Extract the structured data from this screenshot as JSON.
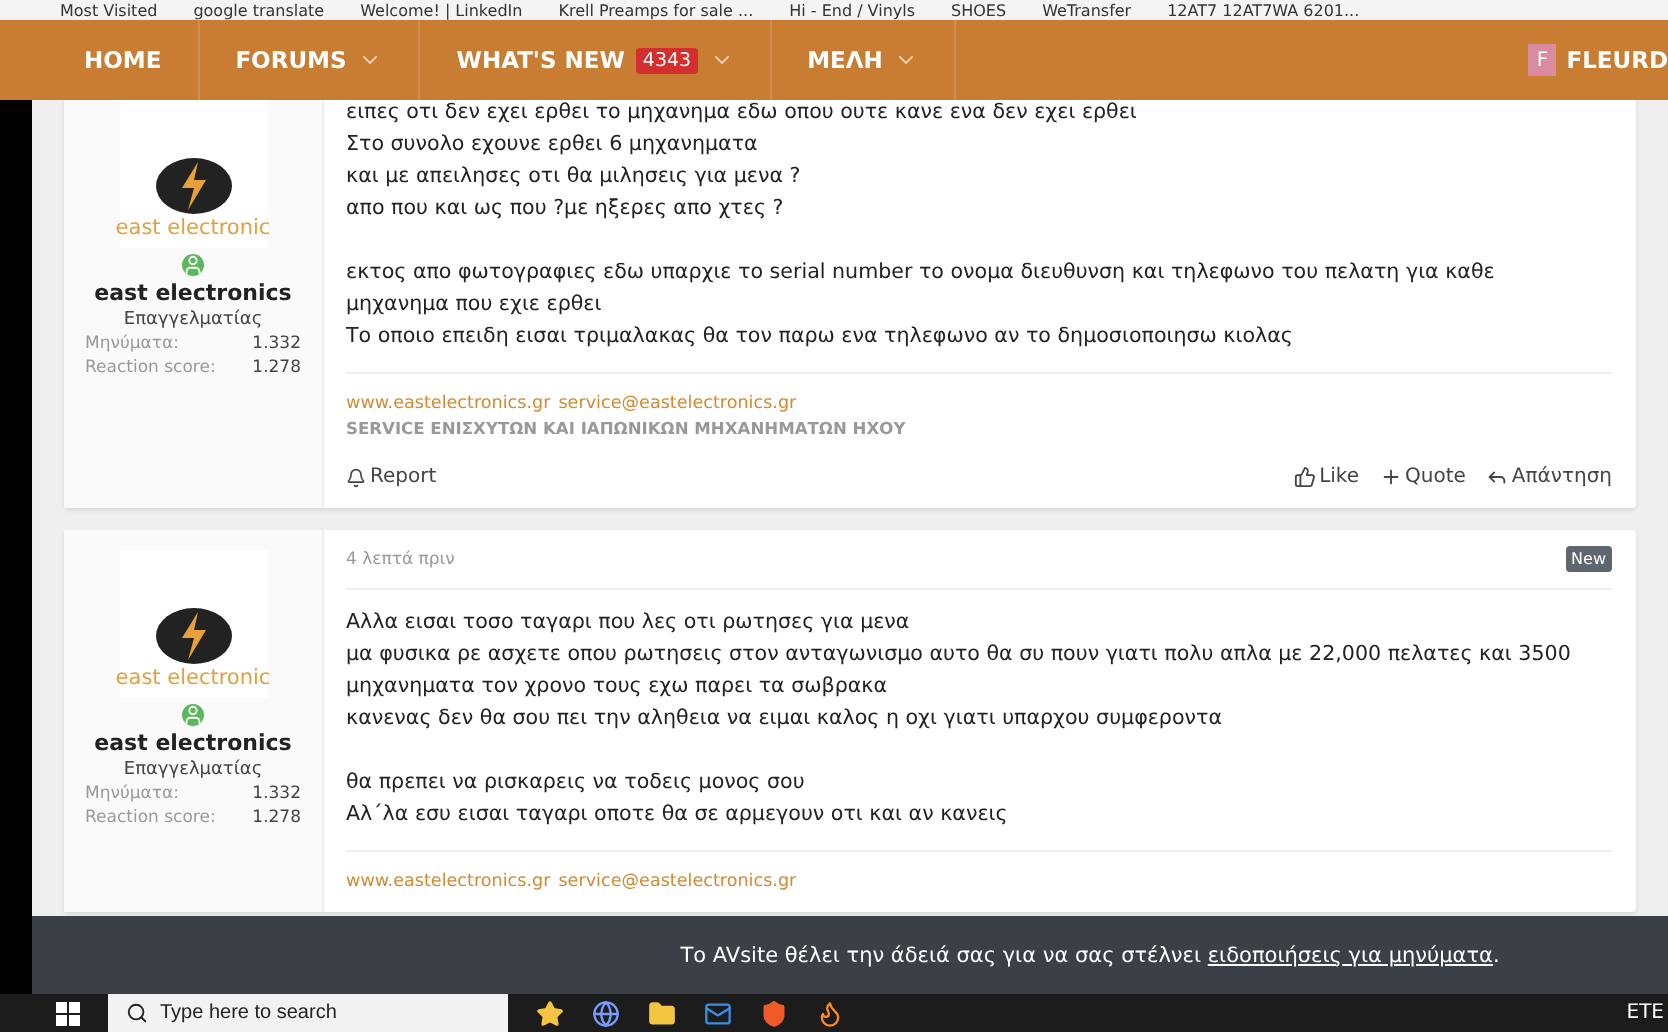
{
  "bookmarks": [
    "Most Visited",
    "google translate",
    "Welcome! | LinkedIn",
    "Krell Preamps for sale ...",
    "Hi - End / Vinyls",
    "SHOES",
    "WeTransfer",
    "12AT7 12AT7WA 6201..."
  ],
  "nav": {
    "items": [
      {
        "label": "HOME",
        "dropdown": false
      },
      {
        "label": "FORUMS",
        "dropdown": true
      },
      {
        "label": "WHAT'S NEW",
        "badge": "4343",
        "dropdown": true
      },
      {
        "label": "ΜΕΛΗ",
        "dropdown": true
      }
    ],
    "user": {
      "initial": "F",
      "name": "FLEURD"
    }
  },
  "posts": [
    {
      "avatar_text": "east electronic",
      "online": true,
      "author": "east electronics",
      "role": "Επαγγελματίας",
      "stats": [
        {
          "label": "Μηνύματα:",
          "value": "1.332"
        },
        {
          "label": "Reaction score:",
          "value": "1.278"
        }
      ],
      "paragraphs": [
        [
          "ειπες οτι δεν εχει ερθει το μηχανημα εδω οπου ουτε κανε ενα δεν εχει ερθει",
          "Στο συνολο εχουνε ερθει 6 μηχανηματα",
          "και με απειλησες οτι θα μιλησεις για μενα ?",
          "απο που και ως που ?με ηξερες απο χτες ?"
        ],
        [
          "εκτος απο φωτογραφιες εδω υπαρχιε το serial number το ονομα διευθυνση και τηλεφωνο του πελατη για καθε",
          "μηχανημα που εχιε ερθει",
          "Το οποιο επειδη εισαι τριμαλακας θα τον παρω ενα τηλεφωνο αν το δημοσιοποιησω κιολας"
        ]
      ],
      "signature": {
        "links": [
          "www.eastelectronics.gr",
          "service@eastelectronics.gr"
        ],
        "tagline": "SERVICE ΕΝΙΣΧΥΤΩΝ ΚΑΙ ΙΑΠΩΝΙΚΩΝ ΜΗΧΑΝΗΜΑΤΩΝ ΗΧΟΥ"
      },
      "report": "Report",
      "actions": [
        {
          "kind": "like",
          "label": "Like"
        },
        {
          "kind": "quote",
          "label": "Quote"
        },
        {
          "kind": "reply",
          "label": "Απάντηση"
        }
      ]
    },
    {
      "avatar_text": "east electronic",
      "online": true,
      "author": "east electronics",
      "role": "Επαγγελματίας",
      "stats": [
        {
          "label": "Μηνύματα:",
          "value": "1.332"
        },
        {
          "label": "Reaction score:",
          "value": "1.278"
        }
      ],
      "time": "4 λεπτά πριν",
      "new_badge": "New",
      "paragraphs": [
        [
          "Αλλα εισαι τοσο ταγαρι που λες οτι ρωτησες για μενα",
          "μα φυσικα ρε ασχετε οπου ρωτησεις στον ανταγωνισμο αυτο θα συ πουν γιατι πολυ απλα με 22,000 πελατες και 3500",
          "μηχανηματα τον χρονο τους εχω παρει τα σωβρακα",
          "κανενας δεν θα σου πει την αληθεια να ειμαι καλος η οχι γιατι υπαρχου συμφεροντα"
        ],
        [
          "θα πρεπει να ρισκαρεις να τοδεις μονος σου",
          "Αλ΄λα εσυ εισαι ταγαρι οποτε θα σε αρμεγουν οτι και αν κανεις"
        ]
      ],
      "signature": {
        "links": [
          "www.eastelectronics.gr",
          "service@eastelectronics.gr"
        ]
      }
    }
  ],
  "notification": {
    "text": "Το AVsite θέλει την άδειά σας για να σας στέλνει",
    "link": "ειδοποιήσεις για μηνύματα",
    "end": "."
  },
  "taskbar": {
    "search_placeholder": "Type here to search",
    "tray_text": "ETE"
  }
}
